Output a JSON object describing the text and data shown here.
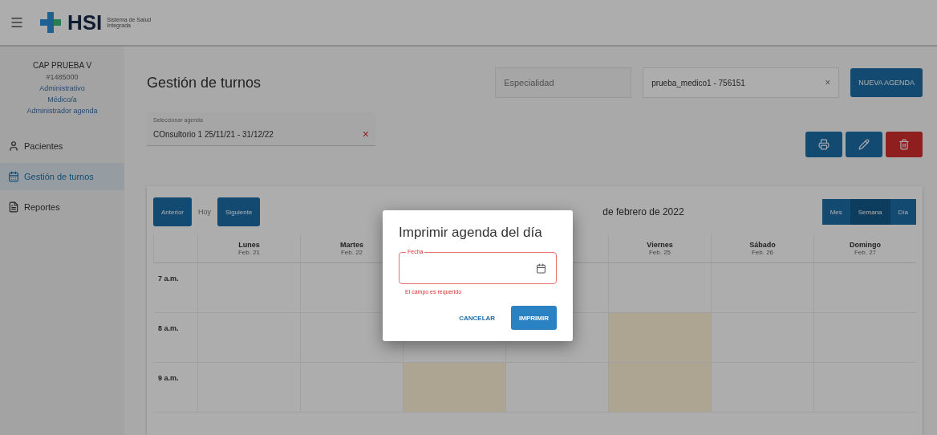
{
  "header": {
    "logo_text": "HSI",
    "logo_subtitle": [
      "Sistema de Salud",
      "Integrada"
    ]
  },
  "sidebar": {
    "institution": "CAP PRUEBA V",
    "code": "#1485000",
    "roles": [
      "Administrativo",
      "Médico/a",
      "Administrador agenda"
    ],
    "items": [
      {
        "label": "Pacientes",
        "kind": "person",
        "selected": false
      },
      {
        "label": "Gestión de turnos",
        "kind": "calendar",
        "selected": true
      },
      {
        "label": "Reportes",
        "kind": "report",
        "selected": false
      }
    ]
  },
  "page": {
    "title": "Gestión de turnos",
    "specialty": {
      "placeholder": "Especialidad"
    },
    "professional": {
      "value": "prueba_medico1 - 756151",
      "clear": "×"
    },
    "new_button": "NUEVA AGENDA",
    "agenda_select": {
      "label": "Seleccionar agenda",
      "value": "COnsultorio 1 25/11/21 - 31/12/22",
      "clear": "×"
    }
  },
  "calendar": {
    "nav": [
      {
        "label": "Anterior",
        "kind": "button"
      },
      {
        "label": "Hoy",
        "kind": "text"
      },
      {
        "label": "Siguiente",
        "kind": "button"
      }
    ],
    "range_title": "de febrero de 2022",
    "views": [
      {
        "label": "Mes",
        "selected": false
      },
      {
        "label": "Semana",
        "selected": true
      },
      {
        "label": "Día",
        "selected": false
      }
    ],
    "days": [
      {
        "name": "Lunes",
        "date": "Feb. 21",
        "slots": [
          {
            "kind": "slot",
            "available": false
          },
          {
            "kind": "slot",
            "available": false
          },
          {
            "kind": "slot",
            "available": false
          }
        ]
      },
      {
        "name": "Martes",
        "date": "Feb. 22",
        "slots": [
          {
            "kind": "slot",
            "available": false
          },
          {
            "kind": "slot",
            "available": false
          },
          {
            "kind": "slot",
            "available": false
          }
        ]
      },
      {
        "slots": [
          {
            "kind": "hidden"
          },
          {
            "kind": "slot",
            "available": false
          },
          {
            "kind": "slot",
            "available": true
          }
        ]
      },
      {
        "slots": [
          {
            "kind": "hidden"
          },
          {
            "kind": "slot",
            "available": false
          },
          {
            "kind": "slot",
            "available": false
          }
        ]
      },
      {
        "name": "Viernes",
        "date": "Feb. 25",
        "slots": [
          {
            "kind": "slot",
            "available": false
          },
          {
            "kind": "slot",
            "available": true
          },
          {
            "kind": "slot",
            "available": true
          }
        ]
      },
      {
        "name": "Sábado",
        "date": "Feb. 26",
        "slots": [
          {
            "kind": "slot",
            "available": false
          },
          {
            "kind": "slot",
            "available": false
          },
          {
            "kind": "slot",
            "available": false
          }
        ]
      },
      {
        "name": "Domingo",
        "date": "Feb. 27",
        "slots": [
          {
            "kind": "slot",
            "available": false
          },
          {
            "kind": "slot",
            "available": false
          },
          {
            "kind": "slot",
            "available": false
          }
        ]
      }
    ],
    "hours": [
      "7 a.m.",
      "8 a.m.",
      "9 a.m."
    ]
  },
  "dialog": {
    "title": "Imprimir agenda del día",
    "field": {
      "label": "Fecha",
      "invalid": true
    },
    "error": "El campo es requerido",
    "buttons": [
      {
        "label": "CANCELAR",
        "kind": "text"
      },
      {
        "label": "IMPRIMIR",
        "kind": "primary"
      }
    ]
  }
}
